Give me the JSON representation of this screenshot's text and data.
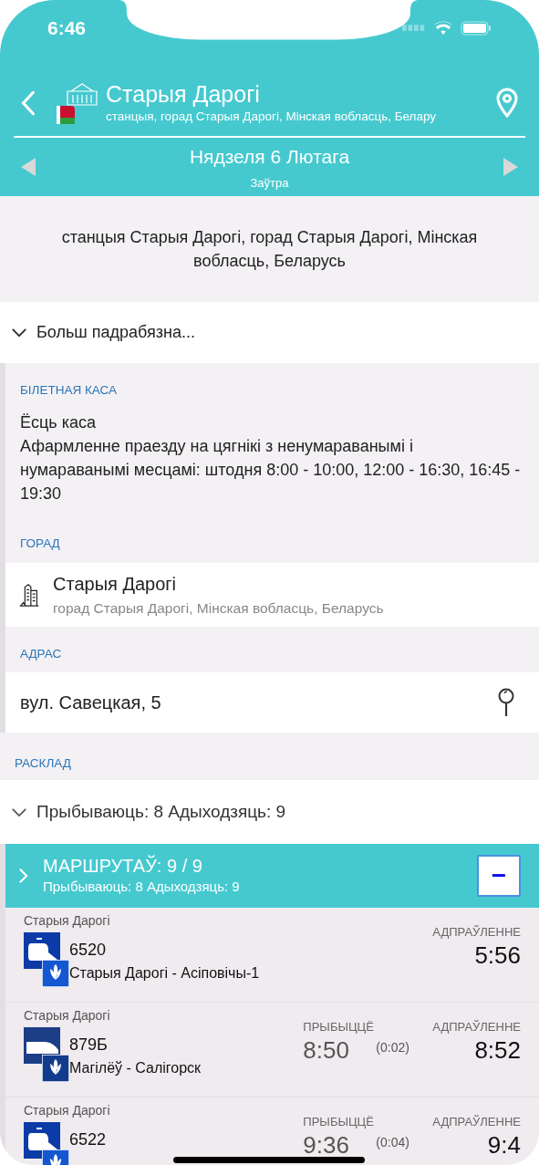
{
  "status_bar": {
    "time": "6:46"
  },
  "header": {
    "title": "Старыя Дарогі",
    "subtitle": "станцыя, горад Старыя Дарогі, Мінская вобласць, Белару",
    "date": "Нядзеля 6 Лютага",
    "date_note": "Заўтра"
  },
  "address_block": "станцыя Старыя Дарогі, горад Старыя Дарогі, Мінская вобласць, Беларусь",
  "more": {
    "label": "Больш падрабязна...",
    "expanded": true
  },
  "details": [
    {
      "kind": "text",
      "label": "БІЛЕТНАЯ КАСА",
      "lines": [
        "Ёсць каса",
        "Афармленне праезду на цягнікі з ненумараванымі і нумараванымі месцамі: штодня 8:00 - 10:00, 12:00 - 16:30, 16:45 - 19:30"
      ]
    },
    {
      "kind": "city",
      "label": "ГОРАД",
      "title": "Старыя Дарогі",
      "subtitle": "горад Старыя Дарогі, Мінская вобласць, Беларусь"
    },
    {
      "kind": "address",
      "label": "АДРАС",
      "title": "вул. Савецкая, 5"
    }
  ],
  "schedule": {
    "label": "РАСКЛАД",
    "summary": "Прыбываюць: 8 Адыходзяць: 9",
    "expanded": true,
    "routes": {
      "title": "МАРШРУТАЎ: 9 / 9",
      "subtitle": "Прыбываюць: 8 Адыходзяць: 9",
      "collapse_button": "−"
    },
    "trains": [
      {
        "kind": "departure",
        "station": "Старыя Дарогі",
        "number": "6520",
        "route": "Старыя Дарогі - Асіповічы-1",
        "departure_label": "АДПРАЎЛЕННЕ",
        "departure": "5:56"
      },
      {
        "kind": "through",
        "station": "Старыя Дарогі",
        "number": "879Б",
        "route": "Магілёў - Салігорск",
        "arrival_label": "ПРЫБЫЦЦЁ",
        "arrival": "8:50",
        "stop": "(0:02)",
        "departure_label": "АДПРАЎЛЕННЕ",
        "departure": "8:52"
      },
      {
        "kind": "through",
        "station": "Старыя Дарогі",
        "number": "6522",
        "arrival_label": "ПРЫБЫЦЦЁ",
        "arrival": "9:36",
        "stop": "(0:04)",
        "departure_label": "АДПРАЎЛЕННЕ",
        "departure": "9:4"
      }
    ]
  }
}
